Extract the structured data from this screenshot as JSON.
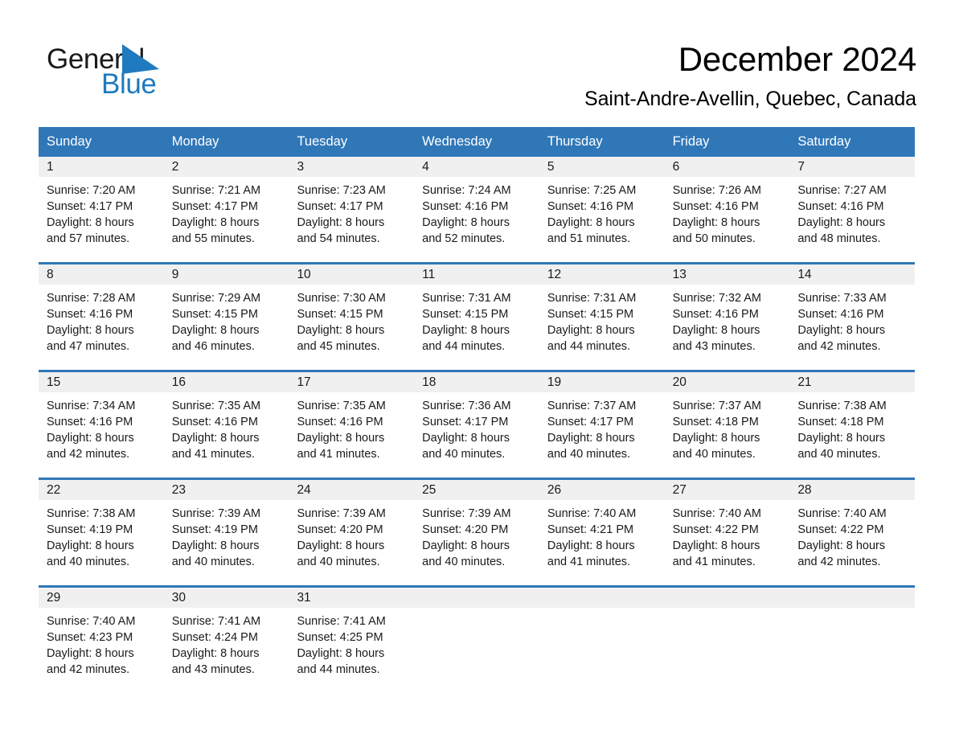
{
  "brand": {
    "name_part1": "General",
    "name_part2": "Blue",
    "logo_icon": "triangle-flag-icon",
    "accent_color": "#1f7ac0"
  },
  "header": {
    "title": "December 2024",
    "subtitle": "Saint-Andre-Avellin, Quebec, Canada"
  },
  "colors": {
    "header_blue": "#3077b8",
    "day_band_gray": "#f0f0f0",
    "text": "#1a1a1a"
  },
  "calendar": {
    "weekdays": [
      "Sunday",
      "Monday",
      "Tuesday",
      "Wednesday",
      "Thursday",
      "Friday",
      "Saturday"
    ],
    "weeks": [
      [
        {
          "day": "1",
          "sunrise": "Sunrise: 7:20 AM",
          "sunset": "Sunset: 4:17 PM",
          "daylight_line1": "Daylight: 8 hours",
          "daylight_line2": "and 57 minutes."
        },
        {
          "day": "2",
          "sunrise": "Sunrise: 7:21 AM",
          "sunset": "Sunset: 4:17 PM",
          "daylight_line1": "Daylight: 8 hours",
          "daylight_line2": "and 55 minutes."
        },
        {
          "day": "3",
          "sunrise": "Sunrise: 7:23 AM",
          "sunset": "Sunset: 4:17 PM",
          "daylight_line1": "Daylight: 8 hours",
          "daylight_line2": "and 54 minutes."
        },
        {
          "day": "4",
          "sunrise": "Sunrise: 7:24 AM",
          "sunset": "Sunset: 4:16 PM",
          "daylight_line1": "Daylight: 8 hours",
          "daylight_line2": "and 52 minutes."
        },
        {
          "day": "5",
          "sunrise": "Sunrise: 7:25 AM",
          "sunset": "Sunset: 4:16 PM",
          "daylight_line1": "Daylight: 8 hours",
          "daylight_line2": "and 51 minutes."
        },
        {
          "day": "6",
          "sunrise": "Sunrise: 7:26 AM",
          "sunset": "Sunset: 4:16 PM",
          "daylight_line1": "Daylight: 8 hours",
          "daylight_line2": "and 50 minutes."
        },
        {
          "day": "7",
          "sunrise": "Sunrise: 7:27 AM",
          "sunset": "Sunset: 4:16 PM",
          "daylight_line1": "Daylight: 8 hours",
          "daylight_line2": "and 48 minutes."
        }
      ],
      [
        {
          "day": "8",
          "sunrise": "Sunrise: 7:28 AM",
          "sunset": "Sunset: 4:16 PM",
          "daylight_line1": "Daylight: 8 hours",
          "daylight_line2": "and 47 minutes."
        },
        {
          "day": "9",
          "sunrise": "Sunrise: 7:29 AM",
          "sunset": "Sunset: 4:15 PM",
          "daylight_line1": "Daylight: 8 hours",
          "daylight_line2": "and 46 minutes."
        },
        {
          "day": "10",
          "sunrise": "Sunrise: 7:30 AM",
          "sunset": "Sunset: 4:15 PM",
          "daylight_line1": "Daylight: 8 hours",
          "daylight_line2": "and 45 minutes."
        },
        {
          "day": "11",
          "sunrise": "Sunrise: 7:31 AM",
          "sunset": "Sunset: 4:15 PM",
          "daylight_line1": "Daylight: 8 hours",
          "daylight_line2": "and 44 minutes."
        },
        {
          "day": "12",
          "sunrise": "Sunrise: 7:31 AM",
          "sunset": "Sunset: 4:15 PM",
          "daylight_line1": "Daylight: 8 hours",
          "daylight_line2": "and 44 minutes."
        },
        {
          "day": "13",
          "sunrise": "Sunrise: 7:32 AM",
          "sunset": "Sunset: 4:16 PM",
          "daylight_line1": "Daylight: 8 hours",
          "daylight_line2": "and 43 minutes."
        },
        {
          "day": "14",
          "sunrise": "Sunrise: 7:33 AM",
          "sunset": "Sunset: 4:16 PM",
          "daylight_line1": "Daylight: 8 hours",
          "daylight_line2": "and 42 minutes."
        }
      ],
      [
        {
          "day": "15",
          "sunrise": "Sunrise: 7:34 AM",
          "sunset": "Sunset: 4:16 PM",
          "daylight_line1": "Daylight: 8 hours",
          "daylight_line2": "and 42 minutes."
        },
        {
          "day": "16",
          "sunrise": "Sunrise: 7:35 AM",
          "sunset": "Sunset: 4:16 PM",
          "daylight_line1": "Daylight: 8 hours",
          "daylight_line2": "and 41 minutes."
        },
        {
          "day": "17",
          "sunrise": "Sunrise: 7:35 AM",
          "sunset": "Sunset: 4:16 PM",
          "daylight_line1": "Daylight: 8 hours",
          "daylight_line2": "and 41 minutes."
        },
        {
          "day": "18",
          "sunrise": "Sunrise: 7:36 AM",
          "sunset": "Sunset: 4:17 PM",
          "daylight_line1": "Daylight: 8 hours",
          "daylight_line2": "and 40 minutes."
        },
        {
          "day": "19",
          "sunrise": "Sunrise: 7:37 AM",
          "sunset": "Sunset: 4:17 PM",
          "daylight_line1": "Daylight: 8 hours",
          "daylight_line2": "and 40 minutes."
        },
        {
          "day": "20",
          "sunrise": "Sunrise: 7:37 AM",
          "sunset": "Sunset: 4:18 PM",
          "daylight_line1": "Daylight: 8 hours",
          "daylight_line2": "and 40 minutes."
        },
        {
          "day": "21",
          "sunrise": "Sunrise: 7:38 AM",
          "sunset": "Sunset: 4:18 PM",
          "daylight_line1": "Daylight: 8 hours",
          "daylight_line2": "and 40 minutes."
        }
      ],
      [
        {
          "day": "22",
          "sunrise": "Sunrise: 7:38 AM",
          "sunset": "Sunset: 4:19 PM",
          "daylight_line1": "Daylight: 8 hours",
          "daylight_line2": "and 40 minutes."
        },
        {
          "day": "23",
          "sunrise": "Sunrise: 7:39 AM",
          "sunset": "Sunset: 4:19 PM",
          "daylight_line1": "Daylight: 8 hours",
          "daylight_line2": "and 40 minutes."
        },
        {
          "day": "24",
          "sunrise": "Sunrise: 7:39 AM",
          "sunset": "Sunset: 4:20 PM",
          "daylight_line1": "Daylight: 8 hours",
          "daylight_line2": "and 40 minutes."
        },
        {
          "day": "25",
          "sunrise": "Sunrise: 7:39 AM",
          "sunset": "Sunset: 4:20 PM",
          "daylight_line1": "Daylight: 8 hours",
          "daylight_line2": "and 40 minutes."
        },
        {
          "day": "26",
          "sunrise": "Sunrise: 7:40 AM",
          "sunset": "Sunset: 4:21 PM",
          "daylight_line1": "Daylight: 8 hours",
          "daylight_line2": "and 41 minutes."
        },
        {
          "day": "27",
          "sunrise": "Sunrise: 7:40 AM",
          "sunset": "Sunset: 4:22 PM",
          "daylight_line1": "Daylight: 8 hours",
          "daylight_line2": "and 41 minutes."
        },
        {
          "day": "28",
          "sunrise": "Sunrise: 7:40 AM",
          "sunset": "Sunset: 4:22 PM",
          "daylight_line1": "Daylight: 8 hours",
          "daylight_line2": "and 42 minutes."
        }
      ],
      [
        {
          "day": "29",
          "sunrise": "Sunrise: 7:40 AM",
          "sunset": "Sunset: 4:23 PM",
          "daylight_line1": "Daylight: 8 hours",
          "daylight_line2": "and 42 minutes."
        },
        {
          "day": "30",
          "sunrise": "Sunrise: 7:41 AM",
          "sunset": "Sunset: 4:24 PM",
          "daylight_line1": "Daylight: 8 hours",
          "daylight_line2": "and 43 minutes."
        },
        {
          "day": "31",
          "sunrise": "Sunrise: 7:41 AM",
          "sunset": "Sunset: 4:25 PM",
          "daylight_line1": "Daylight: 8 hours",
          "daylight_line2": "and 44 minutes."
        },
        {
          "day": "",
          "sunrise": "",
          "sunset": "",
          "daylight_line1": "",
          "daylight_line2": ""
        },
        {
          "day": "",
          "sunrise": "",
          "sunset": "",
          "daylight_line1": "",
          "daylight_line2": ""
        },
        {
          "day": "",
          "sunrise": "",
          "sunset": "",
          "daylight_line1": "",
          "daylight_line2": ""
        },
        {
          "day": "",
          "sunrise": "",
          "sunset": "",
          "daylight_line1": "",
          "daylight_line2": ""
        }
      ]
    ]
  }
}
